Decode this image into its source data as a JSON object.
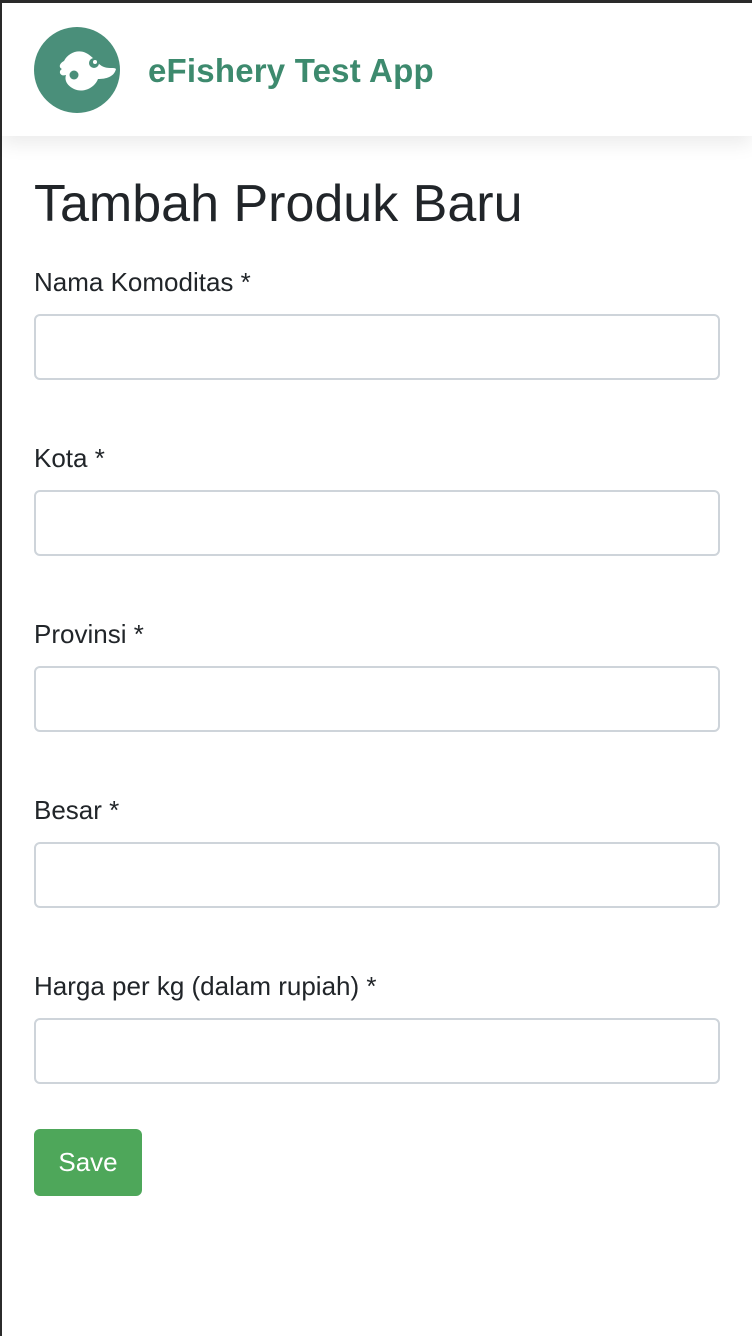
{
  "app": {
    "title": "eFishery Test App",
    "logo_icon": "fish-logo-icon",
    "brand_color": "#3d8a6e"
  },
  "page": {
    "title": "Tambah Produk Baru"
  },
  "form": {
    "fields": [
      {
        "label": "Nama Komoditas *",
        "value": "",
        "placeholder": ""
      },
      {
        "label": "Kota *",
        "value": "",
        "placeholder": ""
      },
      {
        "label": "Provinsi *",
        "value": "",
        "placeholder": ""
      },
      {
        "label": "Besar *",
        "value": "",
        "placeholder": ""
      },
      {
        "label": "Harga per kg (dalam rupiah) *",
        "value": "",
        "placeholder": ""
      }
    ],
    "save_label": "Save",
    "save_color": "#4ea75a"
  }
}
